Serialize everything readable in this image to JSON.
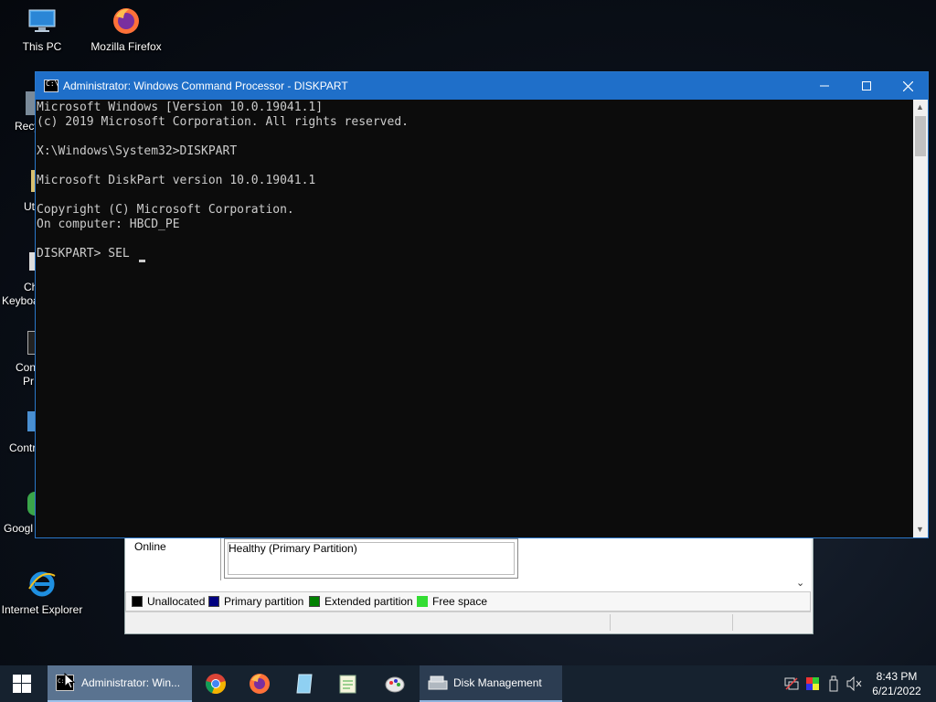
{
  "desktop": {
    "icons": [
      {
        "label": "This PC"
      },
      {
        "label": "Mozilla Firefox"
      },
      {
        "label": "Internet Explorer"
      }
    ],
    "partial_labels": [
      "Recy",
      "Ut",
      "Ch",
      "Keyboa",
      "Con",
      "Pr",
      "Contr",
      "Googl"
    ]
  },
  "cmd_window": {
    "title": "Administrator: Windows Command Processor - DISKPART",
    "lines": [
      "Microsoft Windows [Version 10.0.19041.1]",
      "(c) 2019 Microsoft Corporation. All rights reserved.",
      "",
      "X:\\Windows\\System32>DISKPART",
      "",
      "Microsoft DiskPart version 10.0.19041.1",
      "",
      "Copyright (C) Microsoft Corporation.",
      "On computer: HBCD_PE",
      "",
      "DISKPART> SEL "
    ],
    "controls": {
      "minimize": "minimize",
      "maximize": "maximize",
      "close": "close"
    }
  },
  "disk_management": {
    "status": "Online",
    "partition_health": "Healthy (Primary Partition)",
    "legend": [
      {
        "label": "Unallocated",
        "color": "#000000"
      },
      {
        "label": "Primary partition",
        "color": "#000080"
      },
      {
        "label": "Extended partition",
        "color": "#008000"
      },
      {
        "label": "Free space",
        "color": "#33dd33"
      }
    ]
  },
  "taskbar": {
    "cmd_task": "Administrator: Win...",
    "disk_task": "Disk Management",
    "time": "8:43 PM",
    "date": "6/21/2022"
  },
  "colors": {
    "titlebar": "#1f6fc9",
    "console_bg": "#0c0c0c",
    "console_fg": "#cccccc",
    "taskbar": "#16222f"
  }
}
